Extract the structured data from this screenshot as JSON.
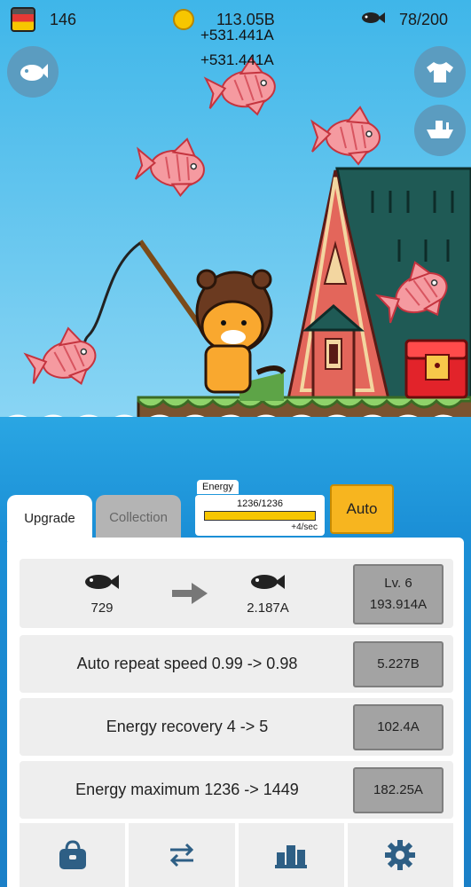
{
  "hud": {
    "cans": "146",
    "coins": "113.05B",
    "fish_count": "78/200"
  },
  "floating_gains": [
    "+531.441A",
    "+531.441A"
  ],
  "tabs": {
    "upgrade": "Upgrade",
    "collection": "Collection"
  },
  "energy": {
    "label": "Energy",
    "value": "1236/1236",
    "rate": "+4/sec",
    "fill_fraction": 1.0
  },
  "auto_button": "Auto",
  "upgrades": {
    "fish_upgrade": {
      "from_value": "729",
      "to_value": "2.187A",
      "level": "Lv. 6",
      "cost": "193.914A"
    },
    "auto_repeat": {
      "label": "Auto repeat speed  0.99 -> 0.98",
      "cost": "5.227B"
    },
    "energy_recovery": {
      "label": "Energy recovery  4 -> 5",
      "cost": "102.4A"
    },
    "energy_maximum": {
      "label": "Energy maximum  1236 -> 1449",
      "cost": "182.25A"
    }
  },
  "bottom_nav": [
    "shop-bag-icon",
    "swap-arrows-icon",
    "ranking-bars-icon",
    "settings-gear-icon"
  ],
  "colors": {
    "sky": "#3fb6e9",
    "sea": "#1b8fd6",
    "accent_yellow": "#f7b51f",
    "fish_pink": "#f59aa0"
  }
}
